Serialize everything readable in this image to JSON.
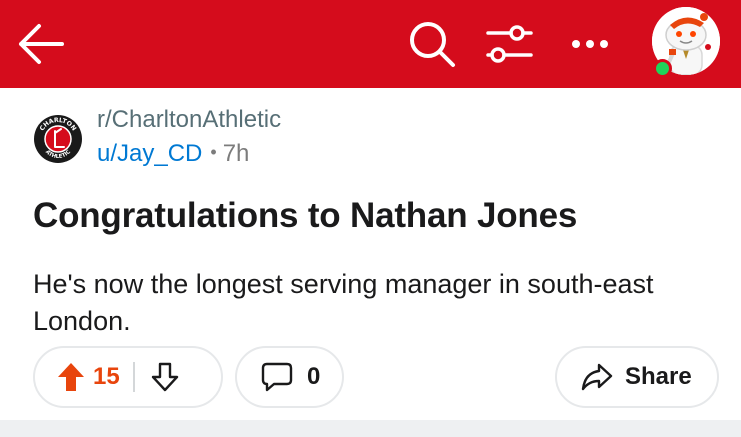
{
  "app": {
    "accent": "#d50c1c"
  },
  "topbar": {
    "back_icon": "back-arrow-icon",
    "search_icon": "search-icon",
    "filter_icon": "filter-sliders-icon",
    "more_icon": "more-dots-icon",
    "avatar_icon": "user-avatar-snoo",
    "online_status_color": "#1fd45a"
  },
  "post": {
    "subreddit": "r/CharltonAthletic",
    "crest_text_top": "CHARLTON",
    "crest_text_bottom": "ATHLETIC",
    "author": "u/Jay_CD",
    "separator": "•",
    "age": "7h",
    "title": "Congratulations to Nathan Jones",
    "body": "He's now the longest serving manager in south-east London."
  },
  "actions": {
    "upvote_count": "15",
    "upvote_color": "#e8450d",
    "comment_count": "0",
    "share_label": "Share"
  }
}
